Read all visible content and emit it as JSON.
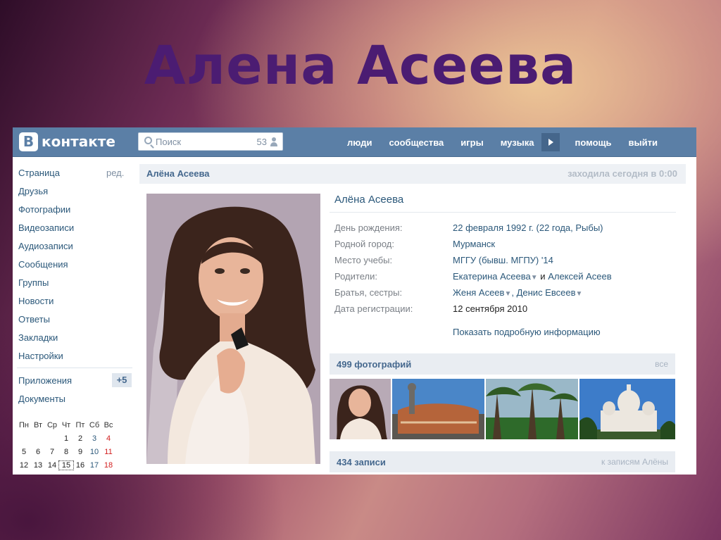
{
  "slide": {
    "title": "Алена Асеева"
  },
  "header": {
    "logo_letter": "В",
    "logo_text": "контакте",
    "search_placeholder": "Поиск",
    "search_count": "53",
    "nav": [
      "люди",
      "сообщества",
      "игры",
      "музыка",
      "помощь",
      "выйти"
    ]
  },
  "sidebar": {
    "items": [
      "Страница",
      "Друзья",
      "Фотографии",
      "Видеозаписи",
      "Аудиозаписи",
      "Сообщения",
      "Группы",
      "Новости",
      "Ответы",
      "Закладки",
      "Настройки"
    ],
    "edit_label": "ред.",
    "apps_label": "Приложения",
    "apps_badge": "+5",
    "docs_label": "Документы"
  },
  "calendar": {
    "weekdays": [
      "Пн",
      "Вт",
      "Ср",
      "Чт",
      "Пт",
      "Сб",
      "Вс"
    ],
    "row1": [
      "1",
      "2",
      "3",
      "4"
    ],
    "row2": [
      "5",
      "6",
      "7",
      "8",
      "9",
      "10",
      "11"
    ],
    "row3": [
      "12",
      "13",
      "14",
      "15",
      "16",
      "17",
      "18"
    ],
    "today": "15"
  },
  "profile": {
    "header_name": "Алёна Асеева",
    "last_seen": "заходила сегодня в 0:00",
    "name": "Алёна Асеева",
    "birthday_label": "День рождения:",
    "birthday_date": "22 февраля 1992 г.",
    "birthday_extra": "(22 года, Рыбы)",
    "hometown_label": "Родной город:",
    "hometown": "Мурманск",
    "study_label": "Место учебы:",
    "study": "МГГУ (бывш. МГПУ) '14",
    "parents_label": "Родители:",
    "parent1": "Екатерина Асеева",
    "parents_and": "и",
    "parent2": "Алексей Асеев",
    "siblings_label": "Братья, сестры:",
    "sibling1": "Женя Асеев",
    "sibling2": "Денис Евсеев",
    "regdate_label": "Дата регистрации:",
    "regdate": "12 сентября 2010",
    "more_info": "Показать подробную информацию"
  },
  "photos_section": {
    "title": "499 фотографий",
    "link": "все"
  },
  "posts_section": {
    "title": "434 записи",
    "link": "к записям Алёны"
  }
}
